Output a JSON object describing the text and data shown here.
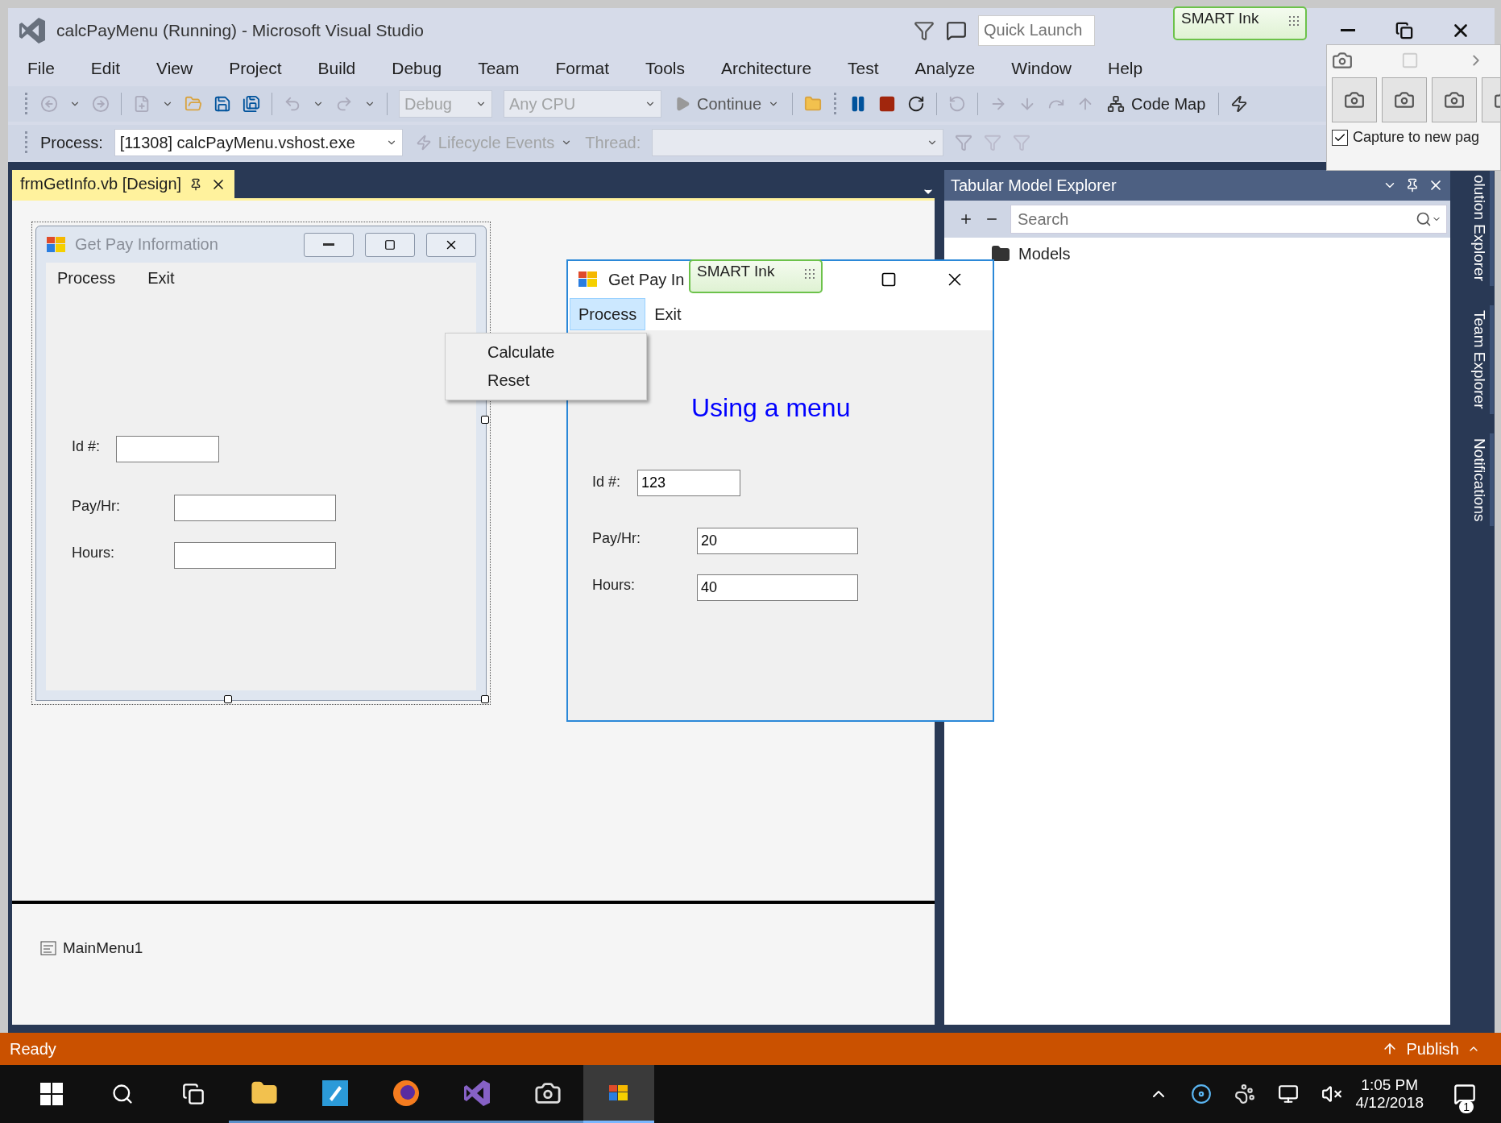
{
  "window": {
    "title": "calcPayMenu (Running) - Microsoft Visual Studio"
  },
  "title_bar": {
    "quick_launch": {
      "placeholder": "Quick Launch"
    }
  },
  "menu_bar": [
    "File",
    "Edit",
    "View",
    "Project",
    "Build",
    "Debug",
    "Team",
    "Format",
    "Tools",
    "Architecture",
    "Test",
    "Analyze",
    "Window",
    "Help"
  ],
  "toolbar": {
    "configuration": "Debug",
    "platform": "Any CPU",
    "continue": "Continue",
    "code_map": "Code Map"
  },
  "debug_location": {
    "process_label": "Process:",
    "process": "[11308] calcPayMenu.vshost.exe",
    "lifecycle": "Lifecycle Events",
    "thread_label": "Thread:"
  },
  "document_tab": {
    "title": "frmGetInfo.vb [Design]",
    "selected": true
  },
  "design_form": {
    "title": "Get Pay Information",
    "menu": [
      "Process",
      "Exit"
    ],
    "fields": [
      {
        "label": "Id #:"
      },
      {
        "label": "Pay/Hr:"
      },
      {
        "label": "Hours:"
      }
    ]
  },
  "context_menu": [
    "Calculate",
    "Reset"
  ],
  "running_form": {
    "title": "Get Pay In",
    "menu": [
      {
        "label": "Process",
        "selected": true
      },
      {
        "label": "Exit",
        "selected": false
      }
    ],
    "heading": "Using a menu",
    "fields": [
      {
        "label": "Id #:",
        "value": "123"
      },
      {
        "label": "Pay/Hr:",
        "value": "20"
      },
      {
        "label": "Hours:",
        "value": "40"
      }
    ]
  },
  "component_tray": [
    "MainMenu1"
  ],
  "tool_window": {
    "title": "Tabular Model Explorer",
    "search": {
      "placeholder": "Search"
    },
    "tree": [
      {
        "label": "Models"
      }
    ]
  },
  "side_tabs": [
    "olution Explorer",
    "Team Explorer",
    "Notifications"
  ],
  "status_bar": {
    "text": "Ready",
    "publish": "Publish"
  },
  "smart_ink_toolbars": [
    {
      "label": "SMART Ink"
    },
    {
      "label": "SMART Ink"
    }
  ],
  "capture_popup": {
    "capture_to_new_page": {
      "label": "Capture to new pag",
      "checked": true
    }
  },
  "taskbar": {
    "apps": [
      {
        "kind": "folder",
        "selected": false
      },
      {
        "kind": "notes",
        "selected": false
      },
      {
        "kind": "browser",
        "selected": false
      },
      {
        "kind": "studio",
        "selected": false
      },
      {
        "kind": "camera",
        "selected": false
      },
      {
        "kind": "winform",
        "selected": true
      }
    ],
    "time": "1:05 PM",
    "date": "4/12/2018",
    "notification_count": "1"
  }
}
